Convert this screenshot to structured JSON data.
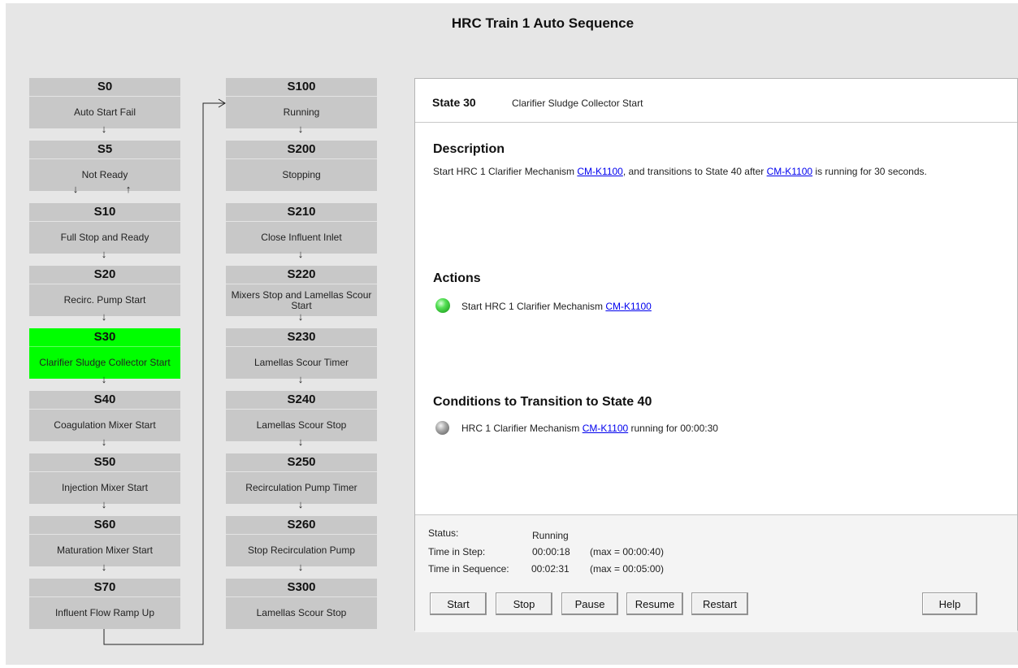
{
  "title": "HRC Train 1 Auto Sequence",
  "states_col1": [
    {
      "code": "S0",
      "name": "Auto Start Fail"
    },
    {
      "code": "S5",
      "name": "Not Ready"
    },
    {
      "code": "S10",
      "name": "Full Stop and Ready"
    },
    {
      "code": "S20",
      "name": "Recirc. Pump Start"
    },
    {
      "code": "S30",
      "name": "Clarifier Sludge Collector Start",
      "active": true
    },
    {
      "code": "S40",
      "name": "Coagulation Mixer Start"
    },
    {
      "code": "S50",
      "name": "Injection Mixer Start"
    },
    {
      "code": "S60",
      "name": "Maturation Mixer Start"
    },
    {
      "code": "S70",
      "name": "Influent Flow Ramp Up"
    }
  ],
  "states_col2": [
    {
      "code": "S100",
      "name": "Running"
    },
    {
      "code": "S200",
      "name": "Stopping"
    },
    {
      "code": "S210",
      "name": "Close Influent Inlet"
    },
    {
      "code": "S220",
      "name": "Mixers Stop and Lamellas Scour Start"
    },
    {
      "code": "S230",
      "name": "Lamellas Scour Timer"
    },
    {
      "code": "S240",
      "name": "Lamellas Scour Stop"
    },
    {
      "code": "S250",
      "name": "Recirculation Pump Timer"
    },
    {
      "code": "S260",
      "name": "Stop Recirculation Pump"
    },
    {
      "code": "S300",
      "name": "Lamellas Scour Stop"
    }
  ],
  "active_color": "#00ff00",
  "panel": {
    "state_label": "State 30",
    "state_name": "Clarifier Sludge Collector Start",
    "description": {
      "heading": "Description",
      "text_1": "Start HRC 1 Clarifier Mechanism ",
      "link_1": "CM-K1100",
      "text_2": ", and transitions to State 40 after ",
      "link_2": "CM-K1100",
      "text_3": " is running for 30 seconds."
    },
    "actions": {
      "heading": "Actions",
      "item_text": "Start HRC 1 Clarifier Mechanism ",
      "item_link": "CM-K1100",
      "lamp": "green-lamp-icon"
    },
    "conditions": {
      "heading": "Conditions to Transition to State 40",
      "item_text": "HRC 1 Clarifier Mechanism ",
      "item_link": "CM-K1100",
      "item_suffix": " running for 00:00:30",
      "lamp": "grey-lamp-icon"
    },
    "status": {
      "status_label": "Status:",
      "status_value": "Running",
      "step_label": "Time in Step:",
      "step_value": "00:00:18",
      "step_max": "(max = 00:00:40)",
      "seq_label": "Time in Sequence:",
      "seq_value": "00:02:31",
      "seq_max": "(max = 00:05:00)"
    },
    "buttons": {
      "start": "Start",
      "stop": "Stop",
      "pause": "Pause",
      "resume": "Resume",
      "restart": "Restart",
      "help": "Help"
    }
  }
}
